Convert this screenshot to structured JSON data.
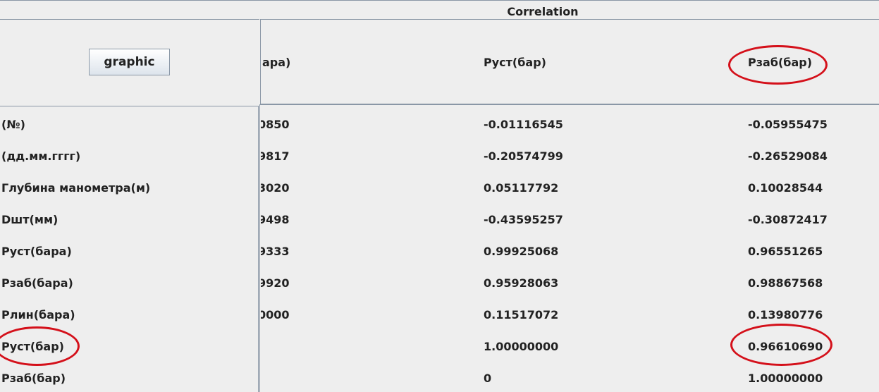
{
  "title": "Correlation",
  "graphic_button": "graphic",
  "column_headers": [
    "ара)",
    "Руст(бар)",
    "Рзаб(бар)"
  ],
  "row_labels": [
    "(№)",
    "(дд.мм.гггг)",
    "Глубина манометра(м)",
    "Dшт(мм)",
    "Руст(бара)",
    "Рзаб(бара)",
    "Рлин(бара)",
    "Руст(бар)",
    "Рзаб(бар)"
  ],
  "rows": [
    {
      "c1": "0850",
      "c2": "-0.01116545",
      "c3": "-0.05955475"
    },
    {
      "c1": "9817",
      "c2": "-0.20574799",
      "c3": "-0.26529084"
    },
    {
      "c1": "3020",
      "c2": "0.05117792",
      "c3": "0.10028544"
    },
    {
      "c1": "9498",
      "c2": "-0.43595257",
      "c3": "-0.30872417"
    },
    {
      "c1": "9333",
      "c2": "0.99925068",
      "c3": "0.96551265"
    },
    {
      "c1": "9920",
      "c2": "0.95928063",
      "c3": "0.98867568"
    },
    {
      "c1": "0000",
      "c2": "0.11517072",
      "c3": "0.13980776"
    },
    {
      "c1": "",
      "c2": "1.00000000",
      "c3": "0.96610690"
    },
    {
      "c1": "",
      "c2": "0",
      "c3": "1.00000000"
    }
  ],
  "annotation_color": "#d4101a"
}
